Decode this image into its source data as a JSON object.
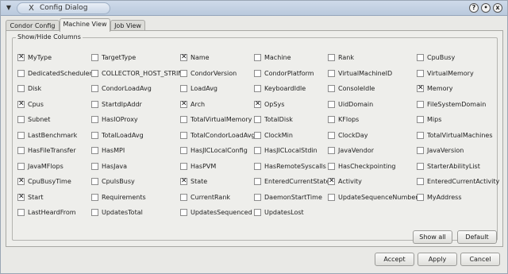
{
  "window": {
    "title": "Config Dialog",
    "menu_glyph": "▼",
    "x_glyph": "X",
    "help_glyph": "?",
    "min_glyph": "•",
    "close_glyph": "x"
  },
  "tabs": [
    {
      "label": "Condor Config",
      "active": false
    },
    {
      "label": "Machine View",
      "active": true
    },
    {
      "label": "Job View",
      "active": false
    }
  ],
  "group": {
    "title": "Show/Hide Columns",
    "check_mark": "✕",
    "columns": [
      [
        {
          "label": "MyType",
          "checked": true
        },
        {
          "label": "DedicatedScheduler",
          "checked": false
        },
        {
          "label": "Disk",
          "checked": false
        },
        {
          "label": "Cpus",
          "checked": true
        },
        {
          "label": "Subnet",
          "checked": false
        },
        {
          "label": "LastBenchmark",
          "checked": false
        },
        {
          "label": "HasFileTransfer",
          "checked": false
        },
        {
          "label": "JavaMFlops",
          "checked": false
        },
        {
          "label": "CpuBusyTime",
          "checked": true
        },
        {
          "label": "Start",
          "checked": true
        },
        {
          "label": "LastHeardFrom",
          "checked": false
        }
      ],
      [
        {
          "label": "TargetType",
          "checked": false
        },
        {
          "label": "COLLECTOR_HOST_STRING",
          "checked": false
        },
        {
          "label": "CondorLoadAvg",
          "checked": false
        },
        {
          "label": "StartdIpAddr",
          "checked": false
        },
        {
          "label": "HasIOProxy",
          "checked": false
        },
        {
          "label": "TotalLoadAvg",
          "checked": false
        },
        {
          "label": "HasMPI",
          "checked": false
        },
        {
          "label": "HasJava",
          "checked": false
        },
        {
          "label": "CpuIsBusy",
          "checked": false
        },
        {
          "label": "Requirements",
          "checked": false
        },
        {
          "label": "UpdatesTotal",
          "checked": false
        }
      ],
      [
        {
          "label": "Name",
          "checked": true
        },
        {
          "label": "CondorVersion",
          "checked": false
        },
        {
          "label": "LoadAvg",
          "checked": false
        },
        {
          "label": "Arch",
          "checked": true
        },
        {
          "label": "TotalVirtualMemory",
          "checked": false
        },
        {
          "label": "TotalCondorLoadAvg",
          "checked": false
        },
        {
          "label": "HasJICLocalConfig",
          "checked": false
        },
        {
          "label": "HasPVM",
          "checked": false
        },
        {
          "label": "State",
          "checked": true
        },
        {
          "label": "CurrentRank",
          "checked": false
        },
        {
          "label": "UpdatesSequenced",
          "checked": false
        }
      ],
      [
        {
          "label": "Machine",
          "checked": false
        },
        {
          "label": "CondorPlatform",
          "checked": false
        },
        {
          "label": "KeyboardIdle",
          "checked": false
        },
        {
          "label": "OpSys",
          "checked": true
        },
        {
          "label": "TotalDisk",
          "checked": false
        },
        {
          "label": "ClockMin",
          "checked": false
        },
        {
          "label": "HasJICLocalStdin",
          "checked": false
        },
        {
          "label": "HasRemoteSyscalls",
          "checked": false
        },
        {
          "label": "EnteredCurrentState",
          "checked": false
        },
        {
          "label": "DaemonStartTime",
          "checked": false
        },
        {
          "label": "UpdatesLost",
          "checked": false
        }
      ],
      [
        {
          "label": "Rank",
          "checked": false
        },
        {
          "label": "VirtualMachineID",
          "checked": false
        },
        {
          "label": "ConsoleIdle",
          "checked": false
        },
        {
          "label": "UidDomain",
          "checked": false
        },
        {
          "label": "KFlops",
          "checked": false
        },
        {
          "label": "ClockDay",
          "checked": false
        },
        {
          "label": "JavaVendor",
          "checked": false
        },
        {
          "label": "HasCheckpointing",
          "checked": false
        },
        {
          "label": "Activity",
          "checked": true
        },
        {
          "label": "UpdateSequenceNumber",
          "checked": false
        }
      ],
      [
        {
          "label": "CpuBusy",
          "checked": false
        },
        {
          "label": "VirtualMemory",
          "checked": false
        },
        {
          "label": "Memory",
          "checked": true
        },
        {
          "label": "FileSystemDomain",
          "checked": false
        },
        {
          "label": "Mips",
          "checked": false
        },
        {
          "label": "TotalVirtualMachines",
          "checked": false
        },
        {
          "label": "JavaVersion",
          "checked": false
        },
        {
          "label": "StarterAbilityList",
          "checked": false
        },
        {
          "label": "EnteredCurrentActivity",
          "checked": false
        },
        {
          "label": "MyAddress",
          "checked": false
        }
      ]
    ]
  },
  "buttons": {
    "show_all": "Show all",
    "default": "Default",
    "accept": "Accept",
    "apply": "Apply",
    "cancel": "Cancel"
  }
}
